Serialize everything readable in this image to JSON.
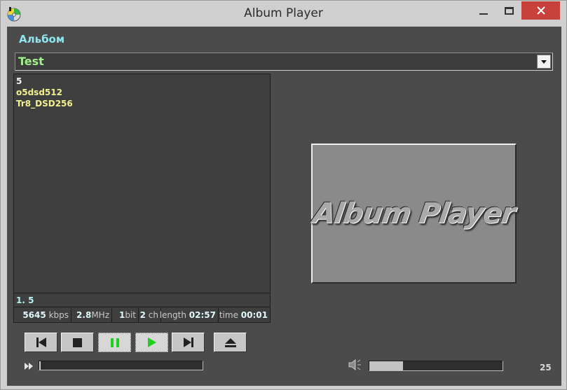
{
  "window": {
    "title": "Album Player"
  },
  "album": {
    "label": "Альбом",
    "selected": "Test"
  },
  "tracks": [
    "5",
    "o5dsd512",
    "Tr8_DSD256"
  ],
  "now_playing": "1. 5",
  "stats": {
    "bitrate_value": "5645",
    "bitrate_unit": "kbps",
    "samplerate_value": "2.8",
    "samplerate_unit": "MHz",
    "bits_value": "1",
    "bits_unit": "bit",
    "channels_value": "2",
    "channels_unit": "ch",
    "length_label": "length",
    "length_value": "02:57",
    "time_label": "time",
    "time_value": "00:01"
  },
  "cover": {
    "text": "Album Player"
  },
  "playback": {
    "state": "playing",
    "seek_fraction": 0.006
  },
  "volume": {
    "value": "25",
    "fraction": 0.25
  },
  "colors": {
    "label_cyan": "#8ee7ef",
    "album_green": "#9ef08d",
    "track_yellow": "#f3f08f",
    "play_green": "#1fd11f",
    "close_red": "#c8413a"
  },
  "icons": {
    "app": "cd-disc-icon",
    "prev": "skip-back-icon",
    "stop": "stop-icon",
    "pause": "pause-icon",
    "play": "play-icon",
    "next": "skip-forward-icon",
    "eject": "eject-icon",
    "seek": "fast-forward-icon",
    "volume": "speaker-icon"
  }
}
